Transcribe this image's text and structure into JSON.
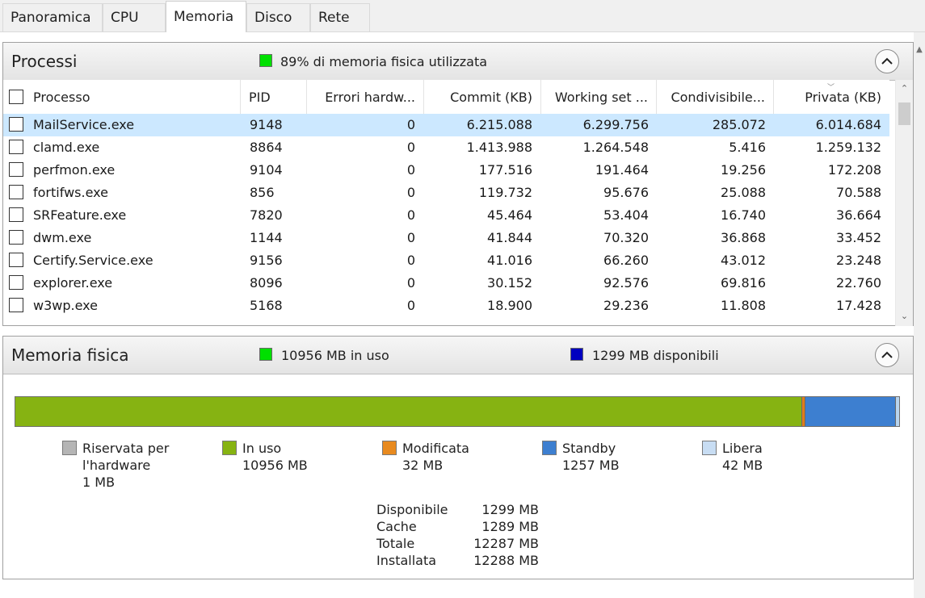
{
  "tabs": [
    "Panoramica",
    "CPU",
    "Memoria",
    "Disco",
    "Rete"
  ],
  "processes": {
    "title": "Processi",
    "status_text": "89% di memoria fisica utilizzata",
    "status_color": "#00e000",
    "columns": [
      "Processo",
      "PID",
      "Errori hardw...",
      "Commit (KB)",
      "Working set ...",
      "Condivisibile...",
      "Privata (KB)"
    ],
    "rows": [
      {
        "name": "MailService.exe",
        "pid": "9148",
        "faults": "0",
        "commit": "6.215.088",
        "ws": "6.299.756",
        "shared": "285.072",
        "private": "6.014.684"
      },
      {
        "name": "clamd.exe",
        "pid": "8864",
        "faults": "0",
        "commit": "1.413.988",
        "ws": "1.264.548",
        "shared": "5.416",
        "private": "1.259.132"
      },
      {
        "name": "perfmon.exe",
        "pid": "9104",
        "faults": "0",
        "commit": "177.516",
        "ws": "191.464",
        "shared": "19.256",
        "private": "172.208"
      },
      {
        "name": "fortifws.exe",
        "pid": "856",
        "faults": "0",
        "commit": "119.732",
        "ws": "95.676",
        "shared": "25.088",
        "private": "70.588"
      },
      {
        "name": "SRFeature.exe",
        "pid": "7820",
        "faults": "0",
        "commit": "45.464",
        "ws": "53.404",
        "shared": "16.740",
        "private": "36.664"
      },
      {
        "name": "dwm.exe",
        "pid": "1144",
        "faults": "0",
        "commit": "41.844",
        "ws": "70.320",
        "shared": "36.868",
        "private": "33.452"
      },
      {
        "name": "Certify.Service.exe",
        "pid": "9156",
        "faults": "0",
        "commit": "41.016",
        "ws": "66.260",
        "shared": "43.012",
        "private": "23.248"
      },
      {
        "name": "explorer.exe",
        "pid": "8096",
        "faults": "0",
        "commit": "30.152",
        "ws": "92.576",
        "shared": "69.816",
        "private": "22.760"
      },
      {
        "name": "w3wp.exe",
        "pid": "5168",
        "faults": "0",
        "commit": "18.900",
        "ws": "29.236",
        "shared": "11.808",
        "private": "17.428"
      }
    ]
  },
  "physical": {
    "title": "Memoria fisica",
    "in_use_text": "10956 MB in uso",
    "available_text": "1299 MB disponibili",
    "in_use_color": "#00e000",
    "available_color": "#0000c0",
    "bar": [
      {
        "name": "In uso",
        "mb": 10956,
        "color": "#86b312"
      },
      {
        "name": "Modificata",
        "mb": 32,
        "color": "#e07c1a"
      },
      {
        "name": "Standby",
        "mb": 1257,
        "color": "#3d7fd0"
      },
      {
        "name": "Libera",
        "mb": 42,
        "color": "#b8d4ee"
      }
    ],
    "legend": [
      {
        "line1": "Riservata per",
        "line2": "l'hardware",
        "line3": "1 MB",
        "color": "#b5b5b5"
      },
      {
        "line1": "In uso",
        "line2": "10956 MB",
        "line3": "",
        "color": "#86b312"
      },
      {
        "line1": "Modificata",
        "line2": "32 MB",
        "line3": "",
        "color": "#e88a1f"
      },
      {
        "line1": "Standby",
        "line2": "1257 MB",
        "line3": "",
        "color": "#3d7fd0"
      },
      {
        "line1": "Libera",
        "line2": "42 MB",
        "line3": "",
        "color": "#c8ddf3"
      }
    ],
    "stats": [
      {
        "label": "Disponibile",
        "value": "1299 MB"
      },
      {
        "label": "Cache",
        "value": "1289 MB"
      },
      {
        "label": "Totale",
        "value": "12287 MB"
      },
      {
        "label": "Installata",
        "value": "12288 MB"
      }
    ]
  }
}
